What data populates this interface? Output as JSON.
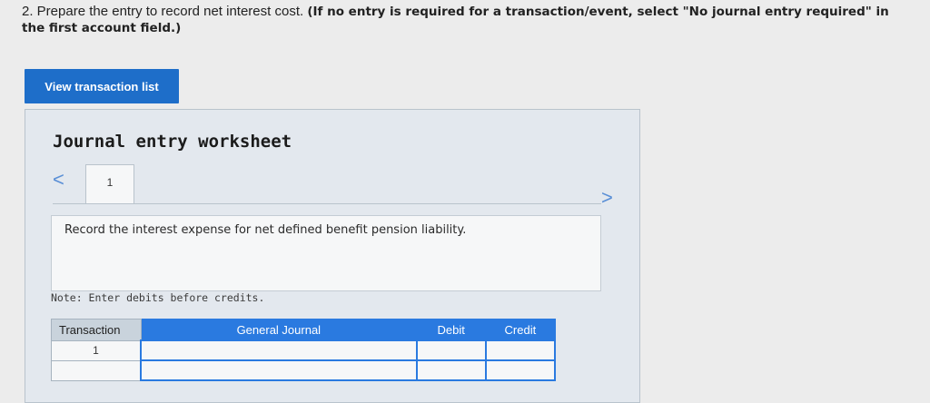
{
  "question": {
    "text_normal": "2. Prepare the entry to record net interest cost. ",
    "text_bold": "(If no entry is required for a transaction/event, select \"No journal entry required\" in the first account field.)"
  },
  "view_button_label": "View transaction list",
  "worksheet": {
    "title": "Journal entry worksheet",
    "prev_icon": "<",
    "next_icon": ">",
    "tabs": [
      {
        "label": "1"
      }
    ],
    "description": "Record the interest expense for net defined benefit pension liability.",
    "note": "Note: Enter debits before credits."
  },
  "table": {
    "headers": {
      "transaction": "Transaction",
      "general_journal": "General Journal",
      "debit": "Debit",
      "credit": "Credit"
    },
    "rows": [
      {
        "transaction": "1",
        "general_journal": "",
        "debit": "",
        "credit": ""
      },
      {
        "transaction": "",
        "general_journal": "",
        "debit": "",
        "credit": ""
      }
    ]
  },
  "colors": {
    "accent": "#2a7ae0",
    "button": "#1e6ec9",
    "worksheet_bg": "#e3e8ee"
  }
}
